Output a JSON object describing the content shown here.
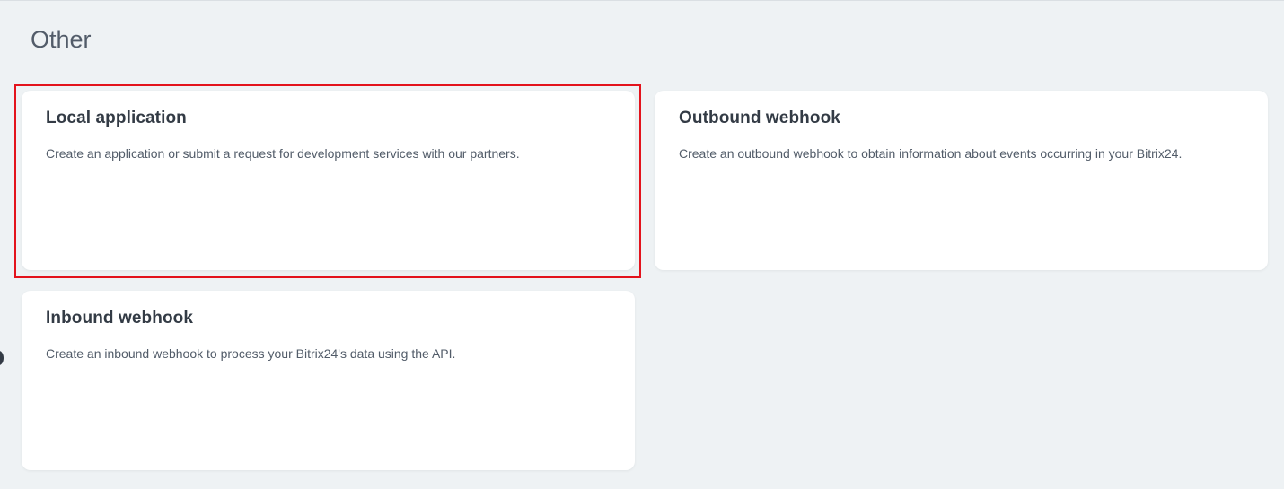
{
  "section": {
    "title": "Other"
  },
  "cards": [
    {
      "title": "Local application",
      "description": "Create an application or submit a request for development services with our partners."
    },
    {
      "title": "Outbound webhook",
      "description": "Create an outbound webhook to obtain information about events occurring in your Bitrix24."
    },
    {
      "title": "Inbound webhook",
      "description": "Create an inbound webhook to process your Bitrix24's data using the API."
    }
  ],
  "colors": {
    "background": "#eef2f4",
    "card": "#ffffff",
    "highlight": "#e3131c",
    "title_text": "#333b45",
    "body_text": "#525c69"
  }
}
